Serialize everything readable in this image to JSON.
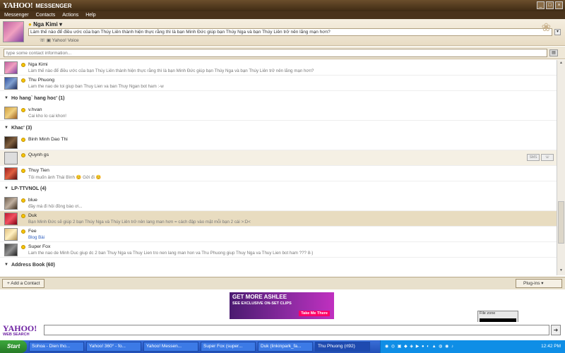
{
  "window": {
    "logo": "YAHOO!",
    "app": "MESSENGER"
  },
  "menu": [
    "Messenger",
    "Contacts",
    "Actions",
    "Help"
  ],
  "profile": {
    "name": "Nga Kimi",
    "status": "Làm thế nào để điều ước của bạn Thúy Liên thành hiện thực rằng thì là bạn Minh Đức giúp bạn Thúy Nga và bạn Thúy Liên trở nên lãng mạn hơn?",
    "voice": "Yahoo! Voice"
  },
  "search": {
    "placeholder": "type some contact information..."
  },
  "contacts_top": [
    {
      "name": "Nga Kimi",
      "status": "Làm thế nào để điều ước của bạn Thúy Liên thành hiện thực rằng thì là bạn Minh Đức giúp bạn Thúy Nga và bạn Thúy Liên trở nên lãng mạn hơn?"
    },
    {
      "name": "Thu Phuong",
      "status": "Lam the nao de toi giup ban Thuy Lien va ban Thuy Ngan bot ham :-w"
    }
  ],
  "group_hohang": {
    "label": "Ho hang` hang hoc' (1)"
  },
  "contacts_hohang": [
    {
      "name": "v.hvan",
      "status": "Cai kho lo cai khon!"
    }
  ],
  "group_khac": {
    "label": "Khac' (3)"
  },
  "contacts_khac": [
    {
      "name": "Binh Minh Dao Thi",
      "status": ""
    },
    {
      "name": "Quynh gs",
      "status": ""
    },
    {
      "name": "Thuy Tien",
      "status": "Tôi muốn ảnh Thái Bình 😊 Gởi đi 😊"
    }
  ],
  "group_lp": {
    "label": "LP-TTVNOL (4)"
  },
  "contacts_lp": [
    {
      "name": "blue",
      "status": "đầy mà đi hỏi đồng bào ơi..."
    },
    {
      "name": "Duk",
      "status": "Bạn Minh Đức sẽ giúp 2 bạn Thúy Nga và Thúy Liên trở nên lang man hơn = cách đập vào mặt mỗi bạn 2 cái >:D<"
    },
    {
      "name": "Fee",
      "status": "Blog Bài"
    },
    {
      "name": "Super Fox",
      "status": "Lam the nao de Minh Duc giup dc 2 ban Thuy Nga va Thuy Lien tro nen lang man hon va Thu Phuong giup Thuy Nga va Thuy Lien bot ham ??? 8-)"
    }
  ],
  "group_addr": {
    "label": "Address Book (60)"
  },
  "bottom": {
    "add_contact": "+ Add a Contact",
    "plugins": "Plug-ins"
  },
  "ad": {
    "line1": "GET MORE ASHLEE",
    "line2": "SEE EXCLUSIVE ON-SET CLIPS",
    "cta": "Take Me There"
  },
  "filezone": {
    "label": "File zone"
  },
  "websearch": {
    "logo": "YAHOO!",
    "label": "WEB SEARCH"
  },
  "taskbar": {
    "start": "Start",
    "tasks": [
      "Sohoa - Dien tho...",
      "Yahoo! 360° - fo...",
      "Yahoo! Messen...",
      "Super Fox (super...",
      "Duk (linkinpark_fa...",
      "Thu Phuong (rt92)"
    ],
    "clock": "12:42 PM"
  }
}
